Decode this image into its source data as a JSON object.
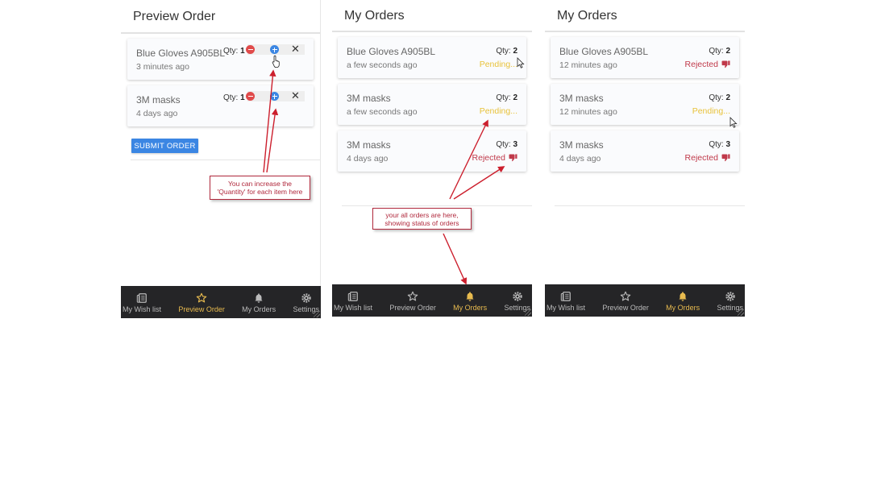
{
  "panels": [
    {
      "title": "Preview Order",
      "items": [
        {
          "name": "Blue Gloves A905BL",
          "ago": "3 minutes ago",
          "qty_label": "Qty:",
          "qty": "1"
        },
        {
          "name": "3M masks",
          "ago": "4 days ago",
          "qty_label": "Qty:",
          "qty": "1"
        }
      ],
      "submit_label": "SUBMIT ORDER",
      "active_nav": "preview-order"
    },
    {
      "title": "My Orders",
      "items": [
        {
          "name": "Blue Gloves A905BL",
          "ago": "a few seconds ago",
          "qty_label": "Qty:",
          "qty": "2",
          "status": "Pending...",
          "status_type": "pending"
        },
        {
          "name": "3M masks",
          "ago": "a few seconds ago",
          "qty_label": "Qty:",
          "qty": "2",
          "status": "Pending...",
          "status_type": "pending"
        },
        {
          "name": "3M masks",
          "ago": "4 days ago",
          "qty_label": "Qty:",
          "qty": "3",
          "status": "Rejected",
          "status_type": "rejected"
        }
      ],
      "active_nav": "my-orders"
    },
    {
      "title": "My Orders",
      "items": [
        {
          "name": "Blue Gloves A905BL",
          "ago": "12 minutes ago",
          "qty_label": "Qty:",
          "qty": "2",
          "status": "Rejected",
          "status_type": "rejected"
        },
        {
          "name": "3M masks",
          "ago": "12 minutes ago",
          "qty_label": "Qty:",
          "qty": "2",
          "status": "Pending...",
          "status_type": "pending"
        },
        {
          "name": "3M masks",
          "ago": "4 days ago",
          "qty_label": "Qty:",
          "qty": "3",
          "status": "Rejected",
          "status_type": "rejected"
        }
      ],
      "active_nav": "my-orders"
    }
  ],
  "nav": [
    {
      "id": "wish-list",
      "label": "My Wish list",
      "icon": "wish-list-icon"
    },
    {
      "id": "preview-order",
      "label": "Preview Order",
      "icon": "star-icon"
    },
    {
      "id": "my-orders",
      "label": "My Orders",
      "icon": "bell-icon"
    },
    {
      "id": "settings",
      "label": "Settings",
      "icon": "gear-icon"
    }
  ],
  "annotations": {
    "quantity_note": "You can increase the 'Quantity' for each item here",
    "orders_note": "your all orders are here, showing status of orders"
  },
  "colors": {
    "accent": "#3b86e3",
    "pending": "#e8c23a",
    "rejected": "#c0394a",
    "nav_active": "#e8bb4f",
    "nav_bg": "#252527",
    "annotation": "#b0283c"
  }
}
